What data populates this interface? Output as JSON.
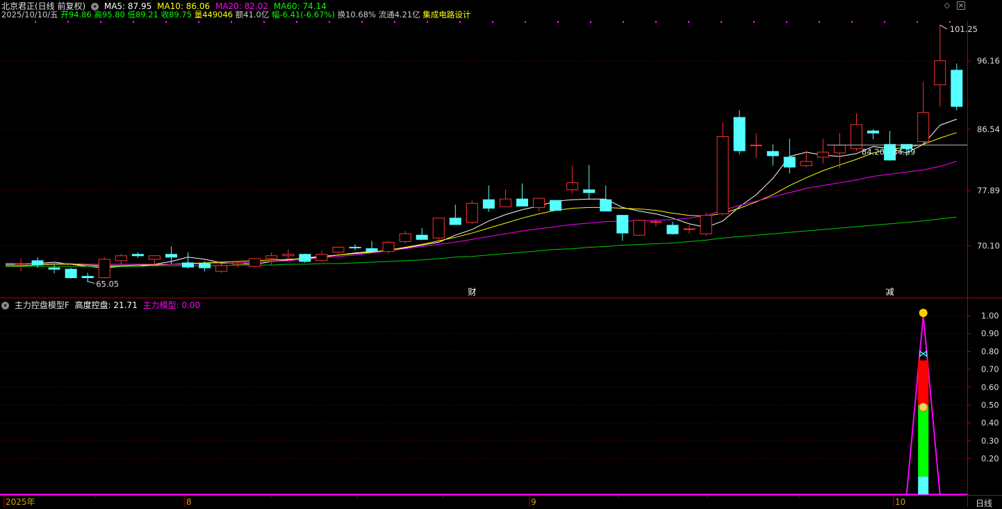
{
  "header": {
    "title": "北京君正(日线 前复权)",
    "ma5": "MA5: 87.95",
    "ma10": "MA10: 86.06",
    "ma20": "MA20: 82.02",
    "ma60": "MA60: 74.14",
    "date": "2025/10/10/五",
    "open": "开94.86",
    "high": "高95.80",
    "low": "低89.21",
    "close": "收89.75",
    "volume": "量449046",
    "amount": "额41.0亿",
    "change": "幅-6.41(-6.67%)",
    "turnover": "换10.68%",
    "float": "流通4.21亿",
    "industry": "集成电路设计"
  },
  "indicator_header": {
    "name": "主力控盘模型F",
    "height_label": "高度控盘: 21.71",
    "model_label": "主力模型: 0.00"
  },
  "price_labels": {
    "high_marker": "101.25",
    "low_marker": "65.05",
    "current_range": "84.20 - 84.39",
    "event_cai": "财",
    "event_jian": "减"
  },
  "x_axis": {
    "labels": [
      "2025年",
      "8",
      "9",
      "10"
    ],
    "period_button": "日线"
  },
  "colors": {
    "up": "#ff3232",
    "down": "#54ffff",
    "ma5": "#ffffff",
    "ma10": "#ffff00",
    "ma20": "#ff00ff",
    "ma60": "#00cc00",
    "grid": "#800000",
    "axis": "#b00000"
  },
  "chart_data": [
    {
      "type": "candlestick",
      "title": "北京君正(日线 前复权)",
      "y_ticks": [
        96.16,
        86.54,
        77.89,
        70.1
      ],
      "ylim": [
        63.9,
        104.0
      ],
      "x_tick_labels": [
        "2025年",
        "8",
        "9",
        "10"
      ],
      "candles": [
        {
          "o": 67.5,
          "h": 68.3,
          "l": 66.5,
          "c": 67.6
        },
        {
          "o": 68.0,
          "h": 68.5,
          "l": 67.0,
          "c": 67.4
        },
        {
          "o": 67.0,
          "h": 67.4,
          "l": 66.2,
          "c": 66.8
        },
        {
          "o": 66.8,
          "h": 67.0,
          "l": 65.5,
          "c": 65.6
        },
        {
          "o": 65.8,
          "h": 66.3,
          "l": 65.1,
          "c": 65.6
        },
        {
          "o": 65.6,
          "h": 68.5,
          "l": 65.5,
          "c": 68.2
        },
        {
          "o": 68.0,
          "h": 69.0,
          "l": 67.4,
          "c": 68.7
        },
        {
          "o": 68.9,
          "h": 69.2,
          "l": 68.4,
          "c": 68.7
        },
        {
          "o": 68.2,
          "h": 68.8,
          "l": 67.5,
          "c": 68.7
        },
        {
          "o": 68.9,
          "h": 70.0,
          "l": 67.5,
          "c": 68.5
        },
        {
          "o": 67.7,
          "h": 69.2,
          "l": 66.9,
          "c": 67.1
        },
        {
          "o": 67.6,
          "h": 67.9,
          "l": 66.5,
          "c": 67.0
        },
        {
          "o": 66.5,
          "h": 67.7,
          "l": 66.3,
          "c": 67.3
        },
        {
          "o": 67.5,
          "h": 67.9,
          "l": 67.0,
          "c": 67.7
        },
        {
          "o": 67.2,
          "h": 68.3,
          "l": 67.0,
          "c": 68.3
        },
        {
          "o": 68.3,
          "h": 69.2,
          "l": 67.4,
          "c": 68.7
        },
        {
          "o": 68.7,
          "h": 69.6,
          "l": 68.1,
          "c": 68.9
        },
        {
          "o": 68.9,
          "h": 69.0,
          "l": 67.7,
          "c": 67.9
        },
        {
          "o": 68.0,
          "h": 69.4,
          "l": 67.9,
          "c": 68.9
        },
        {
          "o": 69.2,
          "h": 70.0,
          "l": 69.0,
          "c": 69.9
        },
        {
          "o": 69.9,
          "h": 70.3,
          "l": 69.5,
          "c": 69.8
        },
        {
          "o": 69.7,
          "h": 70.8,
          "l": 69.2,
          "c": 69.3
        },
        {
          "o": 69.3,
          "h": 70.8,
          "l": 69.0,
          "c": 70.6
        },
        {
          "o": 70.7,
          "h": 72.2,
          "l": 70.4,
          "c": 71.8
        },
        {
          "o": 71.6,
          "h": 72.6,
          "l": 70.9,
          "c": 71.0
        },
        {
          "o": 71.2,
          "h": 74.0,
          "l": 70.8,
          "c": 74.0
        },
        {
          "o": 74.0,
          "h": 75.9,
          "l": 73.1,
          "c": 73.1
        },
        {
          "o": 73.4,
          "h": 76.5,
          "l": 73.2,
          "c": 76.1
        },
        {
          "o": 76.6,
          "h": 78.6,
          "l": 74.9,
          "c": 75.4
        },
        {
          "o": 75.6,
          "h": 78.0,
          "l": 75.6,
          "c": 76.7
        },
        {
          "o": 76.7,
          "h": 78.9,
          "l": 75.9,
          "c": 75.7
        },
        {
          "o": 75.5,
          "h": 76.8,
          "l": 75.0,
          "c": 76.8
        },
        {
          "o": 76.5,
          "h": 76.5,
          "l": 75.1,
          "c": 75.1
        },
        {
          "o": 78.0,
          "h": 81.4,
          "l": 77.5,
          "c": 79.0
        },
        {
          "o": 78.0,
          "h": 81.5,
          "l": 76.6,
          "c": 77.6
        },
        {
          "o": 76.6,
          "h": 78.6,
          "l": 75.0,
          "c": 75.0
        },
        {
          "o": 74.4,
          "h": 74.4,
          "l": 70.8,
          "c": 71.9
        },
        {
          "o": 71.6,
          "h": 73.8,
          "l": 71.5,
          "c": 73.7
        },
        {
          "o": 73.5,
          "h": 73.8,
          "l": 72.8,
          "c": 73.5
        },
        {
          "o": 73.0,
          "h": 73.5,
          "l": 71.7,
          "c": 71.8
        },
        {
          "o": 72.5,
          "h": 73.0,
          "l": 71.8,
          "c": 72.5
        },
        {
          "o": 71.8,
          "h": 74.8,
          "l": 71.5,
          "c": 74.4
        },
        {
          "o": 74.6,
          "h": 87.5,
          "l": 74.4,
          "c": 85.5
        },
        {
          "o": 88.2,
          "h": 89.2,
          "l": 83.0,
          "c": 83.5
        },
        {
          "o": 84.3,
          "h": 86.0,
          "l": 82.5,
          "c": 84.3
        },
        {
          "o": 83.4,
          "h": 84.4,
          "l": 81.4,
          "c": 82.8
        },
        {
          "o": 82.6,
          "h": 85.2,
          "l": 80.3,
          "c": 81.2
        },
        {
          "o": 81.4,
          "h": 83.5,
          "l": 81.2,
          "c": 82.0
        },
        {
          "o": 82.6,
          "h": 85.2,
          "l": 81.7,
          "c": 83.3
        },
        {
          "o": 83.2,
          "h": 86.0,
          "l": 81.0,
          "c": 84.3
        },
        {
          "o": 83.8,
          "h": 88.8,
          "l": 83.5,
          "c": 87.2
        },
        {
          "o": 86.3,
          "h": 86.5,
          "l": 85.1,
          "c": 86.0
        },
        {
          "o": 84.4,
          "h": 86.3,
          "l": 82.1,
          "c": 82.2
        },
        {
          "o": 84.4,
          "h": 84.4,
          "l": 82.8,
          "c": 83.8
        },
        {
          "o": 84.8,
          "h": 93.2,
          "l": 84.5,
          "c": 88.9
        },
        {
          "o": 92.8,
          "h": 101.25,
          "l": 89.7,
          "c": 96.2
        },
        {
          "o": 94.86,
          "h": 95.8,
          "l": 89.21,
          "c": 89.75
        }
      ],
      "series": [
        {
          "name": "MA5",
          "values": [
            67.5,
            67.6,
            67.8,
            67.5,
            67.2,
            67.0,
            67.2,
            67.2,
            67.5,
            67.9,
            68.5,
            68.2,
            67.7,
            67.6,
            67.5,
            67.9,
            68.1,
            68.4,
            68.6,
            68.8,
            69.1,
            69.3,
            69.4,
            69.8,
            70.2,
            70.6,
            71.6,
            72.4,
            73.6,
            74.5,
            75.2,
            75.7,
            76.4,
            76.6,
            76.7,
            76.7,
            75.5,
            75.0,
            74.6,
            74.0,
            73.2,
            72.7,
            73.6,
            75.6,
            77.3,
            79.6,
            82.7,
            83.3,
            82.9,
            82.7,
            83.1,
            84.1,
            83.8,
            83.2,
            84.4,
            87.1,
            87.95
          ]
        },
        {
          "name": "MA10",
          "values": [
            67.3,
            67.4,
            67.5,
            67.5,
            67.4,
            67.3,
            67.3,
            67.4,
            67.4,
            67.5,
            67.6,
            67.7,
            67.8,
            67.9,
            68.0,
            68.1,
            68.2,
            68.3,
            68.5,
            68.8,
            69.0,
            69.2,
            69.5,
            69.9,
            70.3,
            70.8,
            71.3,
            71.9,
            72.6,
            73.3,
            74.0,
            74.6,
            75.1,
            75.4,
            75.5,
            75.5,
            75.4,
            75.3,
            75.1,
            74.7,
            74.4,
            74.3,
            74.7,
            75.4,
            76.3,
            77.3,
            78.6,
            79.7,
            80.7,
            81.5,
            82.3,
            83.2,
            83.7,
            84.0,
            84.4,
            85.3,
            86.06
          ]
        },
        {
          "name": "MA20",
          "values": [
            67.6,
            67.6,
            67.6,
            67.6,
            67.5,
            67.5,
            67.5,
            67.5,
            67.5,
            67.5,
            67.5,
            67.6,
            67.6,
            67.7,
            67.8,
            67.9,
            68.0,
            68.2,
            68.4,
            68.6,
            68.8,
            69.1,
            69.4,
            69.7,
            70.0,
            70.3,
            70.6,
            71.0,
            71.4,
            71.8,
            72.2,
            72.5,
            72.8,
            73.1,
            73.3,
            73.5,
            73.6,
            73.6,
            73.7,
            73.8,
            74.0,
            74.4,
            75.1,
            75.8,
            76.4,
            77.0,
            77.6,
            78.2,
            78.6,
            79.0,
            79.4,
            79.9,
            80.2,
            80.5,
            80.8,
            81.3,
            82.02
          ]
        },
        {
          "name": "MA60",
          "values": [
            67.2,
            67.2,
            67.2,
            67.2,
            67.2,
            67.2,
            67.2,
            67.2,
            67.3,
            67.3,
            67.3,
            67.3,
            67.3,
            67.4,
            67.4,
            67.4,
            67.5,
            67.5,
            67.6,
            67.6,
            67.7,
            67.8,
            67.9,
            68.0,
            68.1,
            68.3,
            68.5,
            68.6,
            68.8,
            69.0,
            69.2,
            69.4,
            69.6,
            69.7,
            69.9,
            70.0,
            70.2,
            70.3,
            70.4,
            70.5,
            70.7,
            70.9,
            71.2,
            71.4,
            71.6,
            71.8,
            72.0,
            72.2,
            72.4,
            72.6,
            72.8,
            73.0,
            73.2,
            73.4,
            73.6,
            73.9,
            74.14
          ]
        }
      ]
    },
    {
      "type": "area",
      "title": "主力控盘模型F",
      "y_ticks": [
        1.0,
        0.9,
        0.8,
        0.7,
        0.6,
        0.5,
        0.4,
        0.3,
        0.2
      ],
      "ylim": [
        -0.01,
        1.02
      ],
      "signal_values": [
        0,
        0,
        0,
        0,
        0,
        0,
        0,
        0,
        0,
        0,
        0,
        0,
        0,
        0,
        0,
        0,
        0,
        0,
        0,
        0,
        0,
        0,
        0,
        0,
        0,
        0,
        0,
        0,
        0,
        0,
        0,
        0,
        0,
        0,
        0,
        0,
        0,
        0,
        0,
        0,
        0,
        0,
        0,
        0,
        0,
        0,
        0,
        0,
        0,
        0,
        0,
        0,
        0,
        0,
        1.0,
        0,
        0
      ],
      "signal_bands": [
        {
          "name": "底部",
          "from": 0,
          "to": 0.1,
          "color": "#54ffff"
        },
        {
          "name": "中部",
          "from": 0.1,
          "to": 0.5,
          "color": "#00ff00"
        },
        {
          "name": "上部",
          "from": 0.5,
          "to": 0.75,
          "color": "#ff0000"
        }
      ],
      "markers": [
        "smile-icon",
        "butterfly-icon",
        "money-bag-icon"
      ]
    }
  ]
}
